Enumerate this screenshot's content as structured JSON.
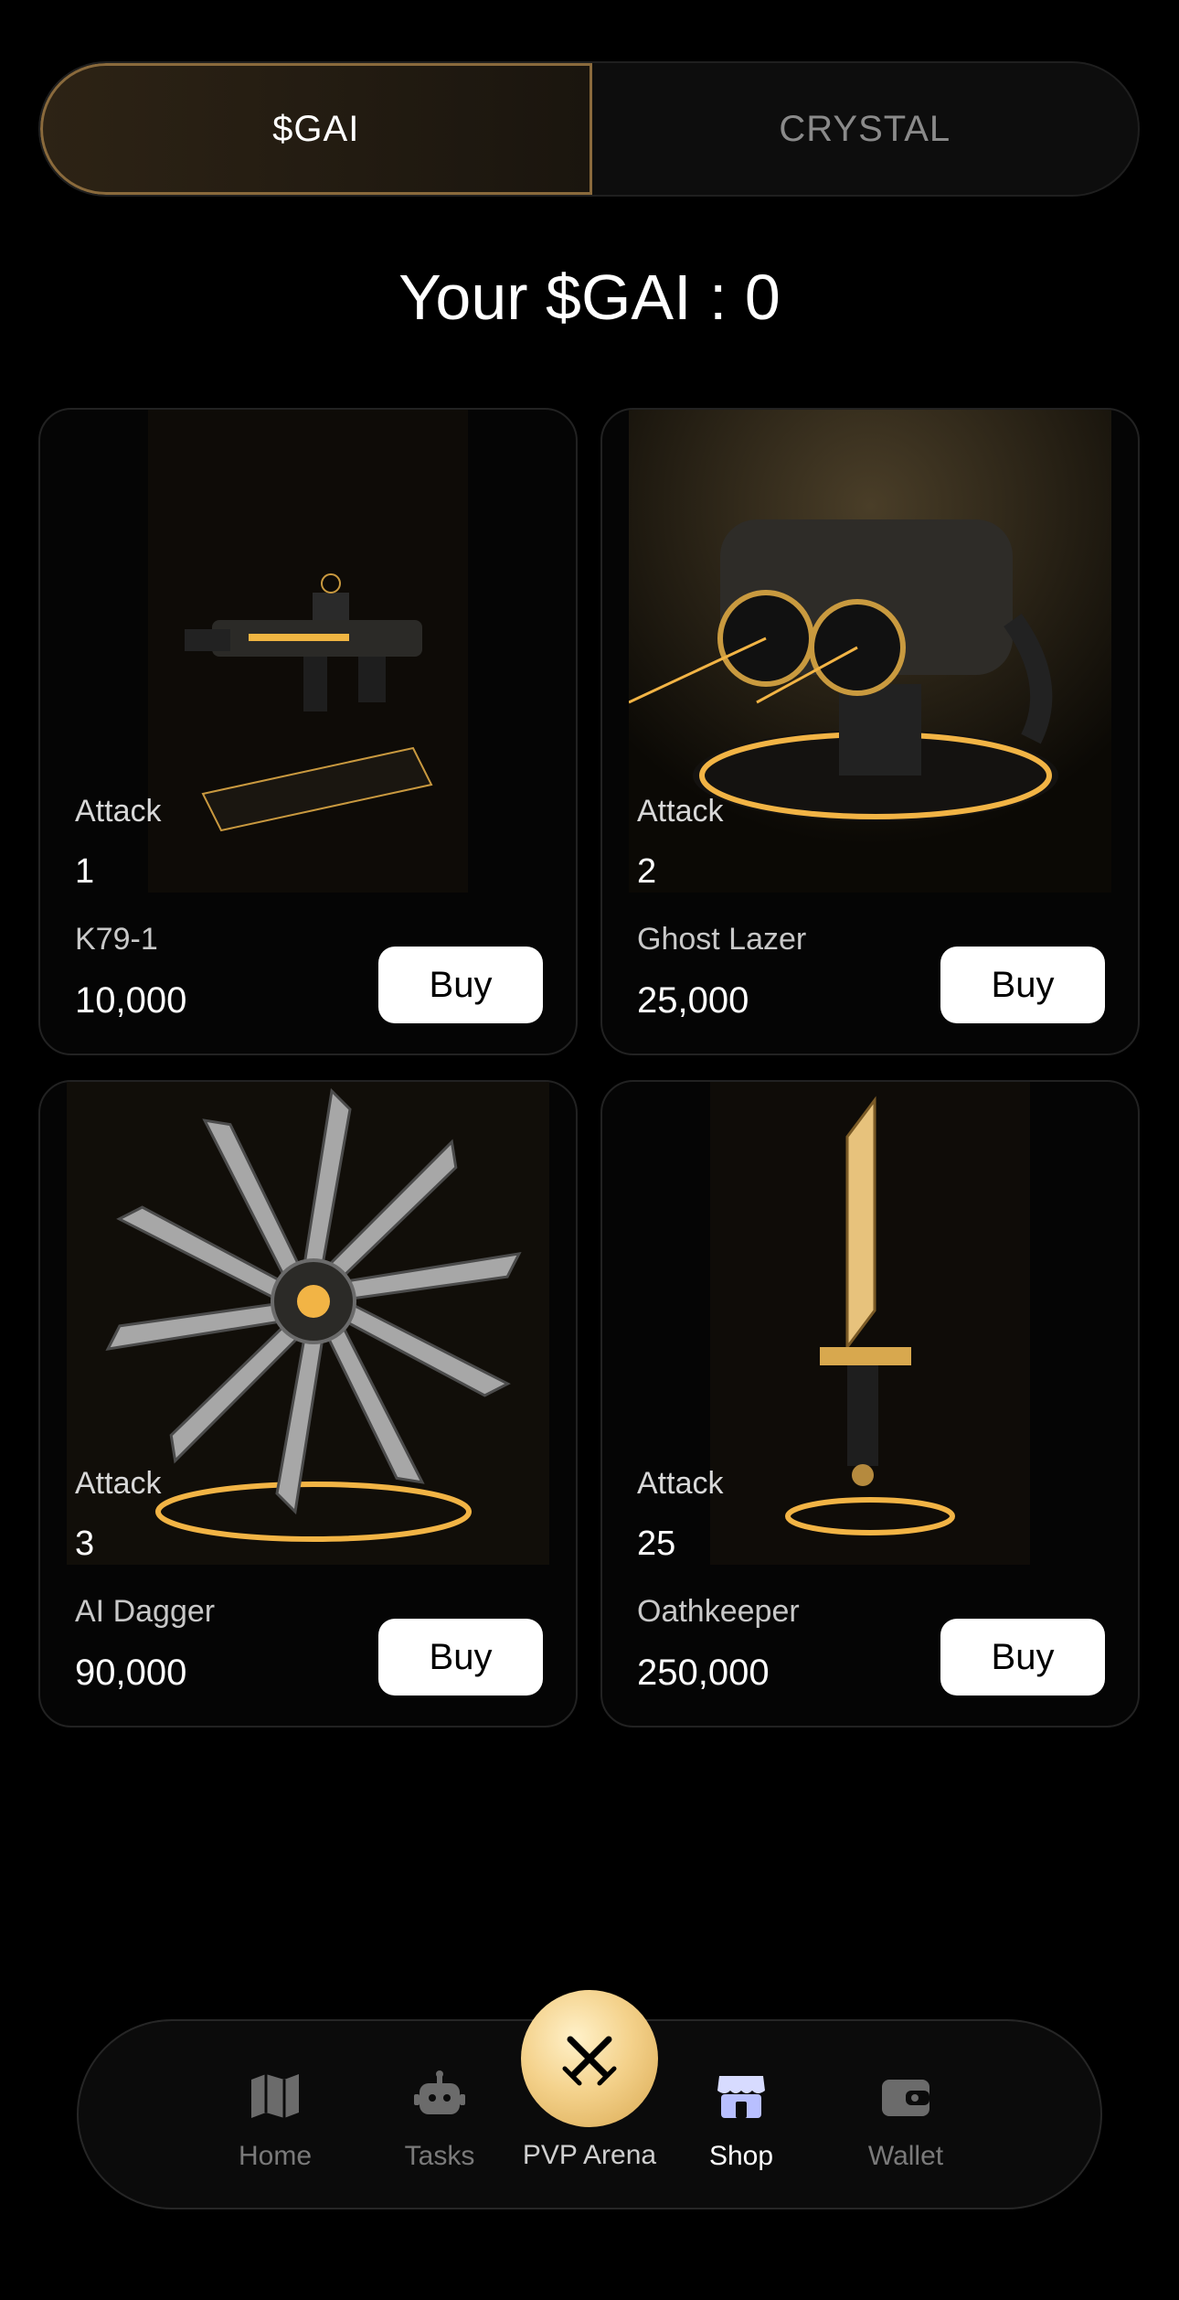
{
  "tabs": {
    "active": "$GAI",
    "inactive": "CRYSTAL"
  },
  "balance_text": "Your $GAI : 0",
  "items": [
    {
      "stat_label": "Attack",
      "stat_value": "1",
      "name": "K79-1",
      "price": "10,000",
      "buy_label": "Buy",
      "icon": "rifle-icon"
    },
    {
      "stat_label": "Attack",
      "stat_value": "2",
      "name": "Ghost Lazer",
      "price": "25,000",
      "buy_label": "Buy",
      "icon": "laser-turret-icon"
    },
    {
      "stat_label": "Attack",
      "stat_value": "3",
      "name": "AI Dagger",
      "price": "90,000",
      "buy_label": "Buy",
      "icon": "blade-wheel-icon"
    },
    {
      "stat_label": "Attack",
      "stat_value": "25",
      "name": "Oathkeeper",
      "price": "250,000",
      "buy_label": "Buy",
      "icon": "sword-icon"
    }
  ],
  "nav": {
    "home": "Home",
    "tasks": "Tasks",
    "arena": "PVP Arena",
    "shop": "Shop",
    "wallet": "Wallet",
    "active": "shop"
  },
  "colors": {
    "gold": "#f2c76e",
    "tab_border": "#8a6a3c",
    "background": "#000000"
  }
}
